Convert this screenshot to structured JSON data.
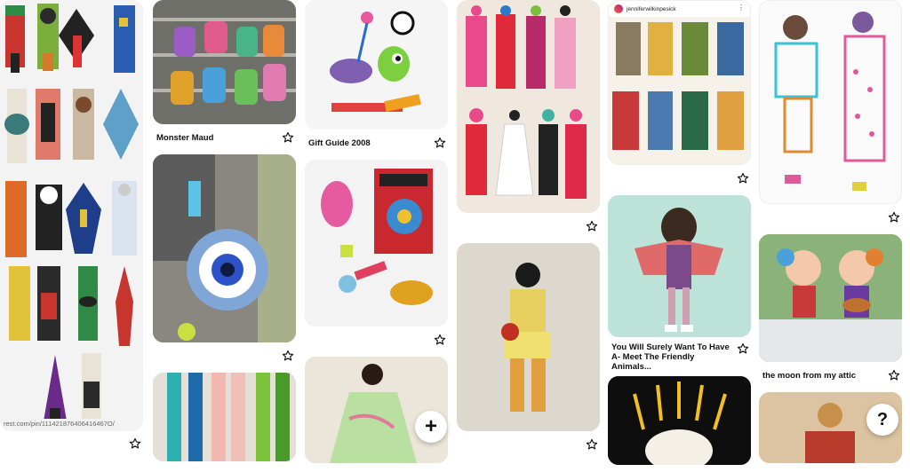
{
  "status_url": "rest.com/pin/111421876406416467O/",
  "pins": {
    "monster_maud": {
      "title": "Monster Maud"
    },
    "gift_guide": {
      "title": "Gift Guide 2008"
    },
    "friendly_animals": {
      "title": "You Will Surely Want To Have A- Meet The Friendly Animals..."
    },
    "moon_attic": {
      "title": "the moon from my attic"
    },
    "instagram": {
      "username": "jenniferwilkinpesick",
      "more": "⋮"
    }
  },
  "fab_add": {
    "label": "+"
  },
  "fab_help": {
    "label": "?"
  },
  "icons": {
    "save": "star-outline-icon",
    "add": "plus-icon",
    "help": "question-icon"
  },
  "colors": {
    "accent": "#111111",
    "background": "#ffffff"
  }
}
